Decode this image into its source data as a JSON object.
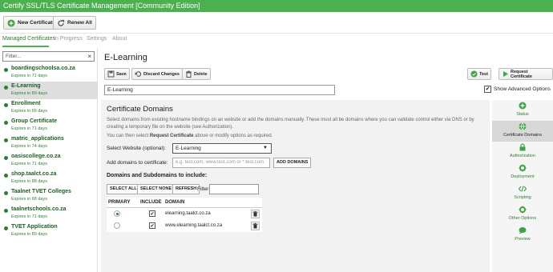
{
  "window": {
    "title": "Certify SSL/TLS Certificate Management [Community Edition]"
  },
  "toolbar": {
    "new_certificate": "New Certificate",
    "renew_all": "Renew All"
  },
  "tabs": [
    "Managed Certificates",
    "In Progress",
    "Settings",
    "About"
  ],
  "sidebar": {
    "filter_placeholder": "Filter...",
    "filter_clear": "×",
    "items": [
      {
        "name": "boardingschoolsa.co.za",
        "expires": "Expires in 71 days"
      },
      {
        "name": "E-Learning",
        "expires": "Expires in 89 days"
      },
      {
        "name": "Enrollment",
        "expires": "Expires in 66 days"
      },
      {
        "name": "Group Certificate",
        "expires": "Expires in 71 days"
      },
      {
        "name": "matric_applications",
        "expires": "Expires in 74 days"
      },
      {
        "name": "oasiscollege.co.za",
        "expires": "Expires in 71 days"
      },
      {
        "name": "shop.taalct.co.za",
        "expires": "Expires in 88 days"
      },
      {
        "name": "Taalnet TVET Colleges",
        "expires": "Expires in 68 days"
      },
      {
        "name": "taalnetschools.co.za",
        "expires": "Expires in 71 days"
      },
      {
        "name": "TVET Application",
        "expires": "Expires in 80 days"
      }
    ]
  },
  "detail": {
    "title": "E-Learning",
    "save": "Save",
    "discard": "Discard Changes",
    "delete": "Delete",
    "test": "Test",
    "request": "Request Certificate",
    "name_value": "E-Learning",
    "show_advanced": "Show Advanced Options"
  },
  "domains": {
    "heading": "Certificate Domains",
    "desc1": "Select domains from existing hostname bindings on an website or add the domains manually. These must all be domains where you can validate control either via DNS or by creating a temporary file on the website (see Authorization).",
    "desc2_pre": "You can then select ",
    "desc2_bold": "Request Certificate",
    "desc2_post": " above or modify options as required.",
    "select_website_label": "Select Website (optional):",
    "select_website_value": "E-Learning",
    "add_domains_label": "Add domains to certificate:",
    "add_domains_placeholder": "e.g. test.com, www.test.com or *.test.com",
    "add_domains_button": "ADD DOMAINS",
    "subheading": "Domains and Subdomains to include:",
    "select_all": "SELECT ALL",
    "select_none": "SELECT NONE",
    "refresh": "REFRESH",
    "filter_label": "Filter:",
    "columns": [
      "PRIMARY",
      "INCLUDE",
      "DOMAIN"
    ],
    "rows": [
      {
        "primary": true,
        "include": true,
        "domain": "elearning.taalct.co.za"
      },
      {
        "primary": false,
        "include": true,
        "domain": "www.elearning.taalct.co.za"
      }
    ]
  },
  "right_nav": [
    "Status",
    "Certificate Domains",
    "Authorization",
    "Deployment",
    "Scripting",
    "Other Options",
    "Preview"
  ]
}
